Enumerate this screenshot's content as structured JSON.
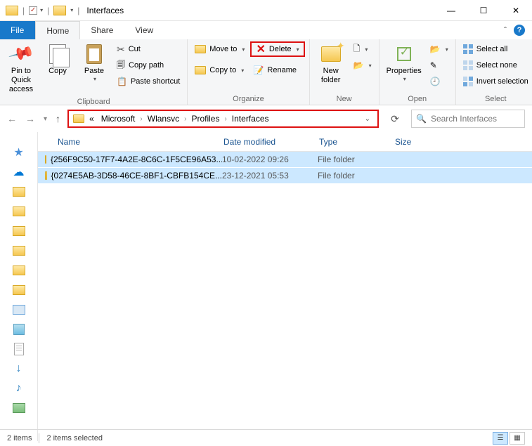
{
  "window": {
    "title": "Interfaces"
  },
  "tabs": {
    "file": "File",
    "home": "Home",
    "share": "Share",
    "view": "View"
  },
  "ribbon": {
    "clipboard": {
      "label": "Clipboard",
      "pin": "Pin to Quick\naccess",
      "copy": "Copy",
      "paste": "Paste",
      "cut": "Cut",
      "copypath": "Copy path",
      "pasteshortcut": "Paste shortcut"
    },
    "organize": {
      "label": "Organize",
      "moveto": "Move to",
      "copyto": "Copy to",
      "delete": "Delete",
      "rename": "Rename"
    },
    "new": {
      "label": "New",
      "newfolder": "New\nfolder"
    },
    "open": {
      "label": "Open",
      "properties": "Properties"
    },
    "select": {
      "label": "Select",
      "selectall": "Select all",
      "selectnone": "Select none",
      "invert": "Invert selection"
    }
  },
  "breadcrumbs": {
    "prefix": "«",
    "parts": [
      "Microsoft",
      "Wlansvc",
      "Profiles",
      "Interfaces"
    ]
  },
  "search": {
    "placeholder": "Search Interfaces"
  },
  "columns": {
    "name": "Name",
    "date": "Date modified",
    "type": "Type",
    "size": "Size"
  },
  "rows": [
    {
      "name": "{256F9C50-17F7-4A2E-8C6C-1F5CE96A53...",
      "date": "10-02-2022 09:26",
      "type": "File folder"
    },
    {
      "name": "{0274E5AB-3D58-46CE-8BF1-CBFB154CE...",
      "date": "23-12-2021 05:53",
      "type": "File folder"
    }
  ],
  "status": {
    "count": "2 items",
    "selected": "2 items selected"
  }
}
